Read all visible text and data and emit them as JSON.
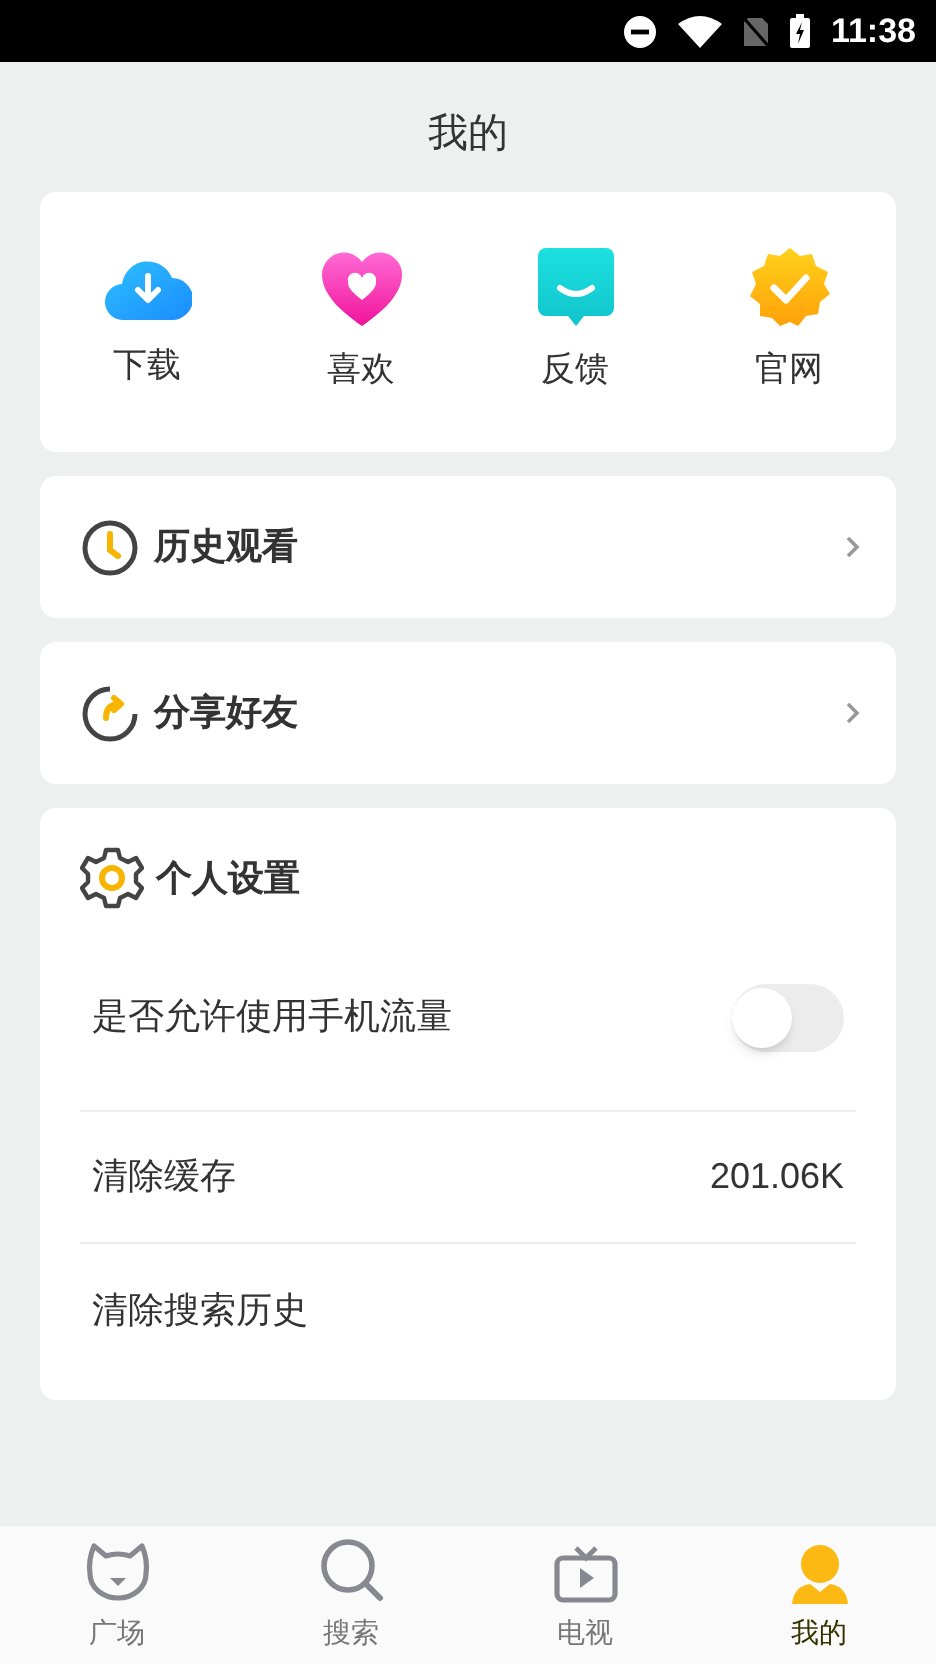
{
  "status_bar": {
    "time": "11:38"
  },
  "title": "我的",
  "shortcuts": [
    {
      "kind": "download",
      "label": "下载"
    },
    {
      "kind": "like",
      "label": "喜欢"
    },
    {
      "kind": "feedback",
      "label": "反馈"
    },
    {
      "kind": "website",
      "label": "官网"
    }
  ],
  "menu": [
    {
      "kind": "history",
      "label": "历史观看"
    },
    {
      "kind": "share",
      "label": "分享好友"
    }
  ],
  "settings": {
    "title": "个人设置",
    "items": [
      {
        "kind": "switch",
        "label": "是否允许使用手机流量",
        "on": false
      },
      {
        "kind": "value",
        "label": "清除缓存",
        "value": "201.06K"
      },
      {
        "kind": "plain",
        "label": "清除搜索历史"
      }
    ]
  },
  "tabs": [
    {
      "kind": "square",
      "label": "广场",
      "selected": false
    },
    {
      "kind": "search",
      "label": "搜索",
      "selected": false
    },
    {
      "kind": "tv",
      "label": "电视",
      "selected": false
    },
    {
      "kind": "me",
      "label": "我的",
      "selected": true
    }
  ]
}
